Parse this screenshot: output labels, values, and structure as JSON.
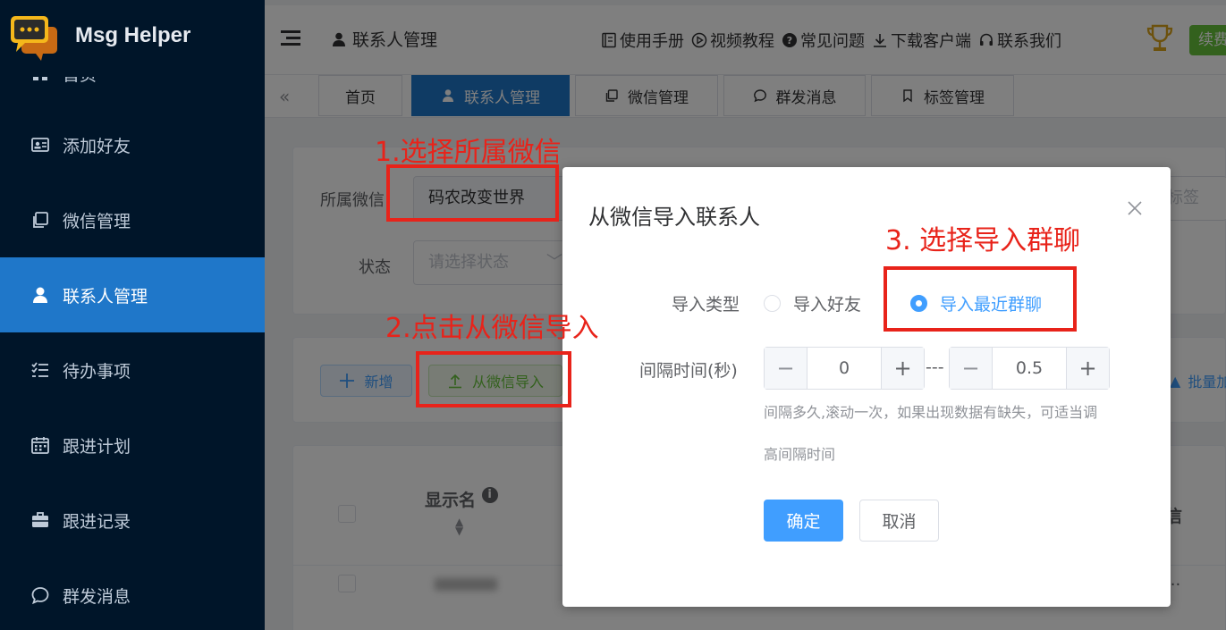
{
  "app": {
    "name": "Msg Helper"
  },
  "sidebar": {
    "items": [
      {
        "label": "首页",
        "icon": "grid-icon"
      },
      {
        "label": "添加好友",
        "icon": "id-card-icon"
      },
      {
        "label": "微信管理",
        "icon": "copy-icon"
      },
      {
        "label": "联系人管理",
        "icon": "user-icon",
        "active": true
      },
      {
        "label": "待办事项",
        "icon": "checklist-icon"
      },
      {
        "label": "跟进计划",
        "icon": "calendar-icon"
      },
      {
        "label": "跟进记录",
        "icon": "briefcase-icon"
      },
      {
        "label": "群发消息",
        "icon": "chat-bubble-icon"
      }
    ]
  },
  "header": {
    "page_title": "联系人管理",
    "links": [
      "使用手册",
      "视频教程",
      "常见问题",
      "下载客户端",
      "联系我们"
    ],
    "renew_label": "续费"
  },
  "tabs": [
    {
      "label": "首页"
    },
    {
      "label": "联系人管理",
      "active": true
    },
    {
      "label": "微信管理"
    },
    {
      "label": "群发消息"
    },
    {
      "label": "标签管理"
    }
  ],
  "filter": {
    "wechat_label": "所属微信",
    "wechat_value": "码农改变世界",
    "status_label": "状态",
    "status_placeholder": "请选择状态",
    "tag_placeholder": "标签"
  },
  "toolbar": {
    "add_label": "新增",
    "import_label": "从微信导入",
    "batch_label": "批量加"
  },
  "table": {
    "display_name_header": "显示名",
    "right_header_partial": "信",
    "ellipsis": "..."
  },
  "dialog": {
    "title": "从微信导入联系人",
    "import_type_label": "导入类型",
    "options": [
      {
        "label": "导入好友",
        "checked": false
      },
      {
        "label": "导入最近群聊",
        "checked": true
      }
    ],
    "interval_label": "间隔时间(秒)",
    "interval_min": "0",
    "interval_max": "0.5",
    "interval_separator": "---",
    "hint_line1": "间隔多久,滚动一次，如果出现数据有缺失，可适当调",
    "hint_line2": "高间隔时间",
    "ok_label": "确定",
    "cancel_label": "取消"
  },
  "annotations": {
    "step1": "1.选择所属微信",
    "step2": "2.点击从微信导入",
    "step3": "3. 选择导入群聊"
  },
  "colors": {
    "sidebar_bg": "#001529",
    "active_blue": "#1f77c9",
    "primary": "#409eff",
    "success": "#67c23a",
    "annotation_red": "#e8231a"
  }
}
